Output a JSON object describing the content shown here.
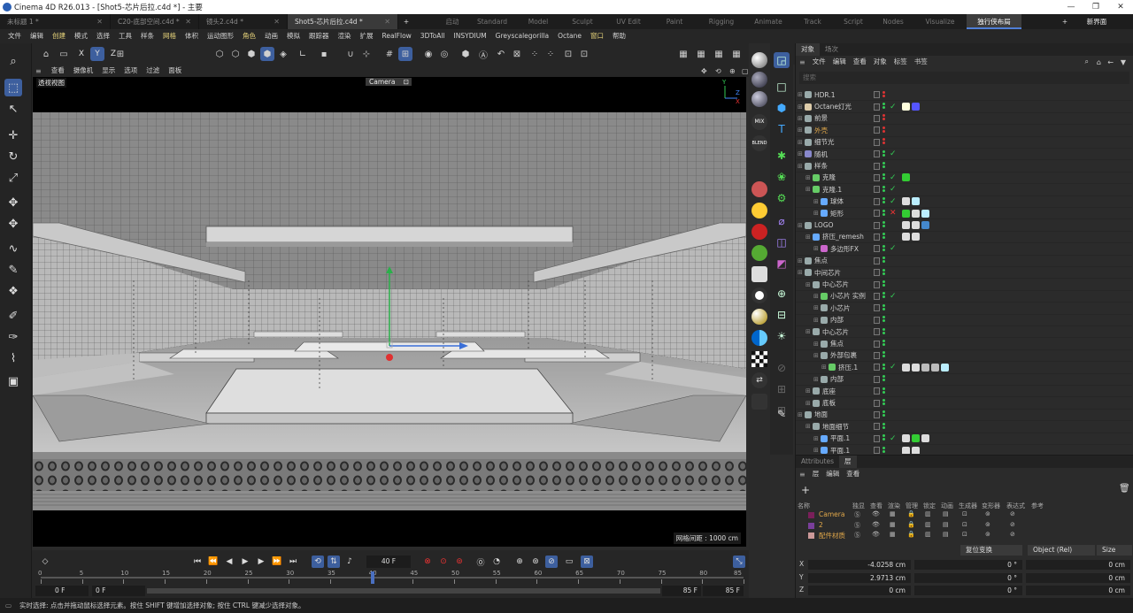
{
  "window": {
    "title": "Cinema 4D R26.013 - [Shot5-芯片后拉.c4d *] - 主要"
  },
  "file_tabs": [
    {
      "label": "未标题 1 *",
      "active": false
    },
    {
      "label": "C20-底部空间.c4d *",
      "active": false
    },
    {
      "label": "镜头2.c4d *",
      "active": false
    },
    {
      "label": "Shot5-芯片后拉.c4d *",
      "active": true
    }
  ],
  "new_tab": "+",
  "layouts": [
    "启动",
    "Standard",
    "Model",
    "Sculpt",
    "UV Edit",
    "Paint",
    "Rigging",
    "Animate",
    "Track",
    "Script",
    "Nodes",
    "Visualize",
    "独行侠布局"
  ],
  "layout_add": "+",
  "new_layout": "新界面",
  "menu": [
    "文件",
    "编辑",
    "创建",
    "模式",
    "选择",
    "工具",
    "样条",
    "网格",
    "体积",
    "运动图形",
    "角色",
    "动画",
    "模拟",
    "跟踪器",
    "渲染",
    "扩展",
    "RealFlow",
    "3DToAll",
    "INSYDIUM",
    "Greyscalegorilla",
    "Octane",
    "窗口",
    "帮助"
  ],
  "menu_highlight": [
    "创建",
    "网格",
    "角色",
    "窗口"
  ],
  "axis_toggles": [
    "X",
    "Y",
    "Z"
  ],
  "viewport": {
    "menu": [
      "查看",
      "摄像机",
      "显示",
      "选项",
      "过滤",
      "面板"
    ],
    "label": "透视视图",
    "camera": "Camera",
    "grid_spacing": "网格间距 : 1000 cm",
    "axis": {
      "y": "Y",
      "z": "Z",
      "x": "X"
    }
  },
  "object_manager": {
    "tabs": [
      "对象",
      "场次"
    ],
    "menu": [
      "文件",
      "编辑",
      "查看",
      "对象",
      "标签",
      "书签"
    ],
    "search_placeholder": "搜索",
    "rows": [
      {
        "name": "HDR.1",
        "indent": 0,
        "color": "#d0d0d0",
        "icon": "#9aa",
        "dots": [
          "#d33",
          "#d33"
        ],
        "check": "",
        "tags": []
      },
      {
        "name": "Octane灯光",
        "indent": 0,
        "color": "#d0d0d0",
        "icon": "#dca",
        "dots": [
          "#3c5",
          "#3c5"
        ],
        "check": "✓",
        "tags": [
          "#ffd",
          "#55f"
        ]
      },
      {
        "name": "前景",
        "indent": 0,
        "color": "#d0d0d0",
        "icon": "#9aa",
        "dots": [
          "#d33",
          "#d33"
        ],
        "check": "",
        "tags": []
      },
      {
        "name": "外壳",
        "indent": 0,
        "color": "#e2a84a",
        "icon": "#9aa",
        "dots": [
          "#d33",
          "#d33"
        ],
        "check": "",
        "tags": []
      },
      {
        "name": "细节光",
        "indent": 0,
        "color": "#d0d0d0",
        "icon": "#9aa",
        "dots": [
          "#d33",
          "#d33"
        ],
        "check": "",
        "tags": []
      },
      {
        "name": "随机",
        "indent": 0,
        "color": "#d0d0d0",
        "icon": "#88c",
        "dots": [
          "#3c5",
          "#3c5"
        ],
        "check": "✓",
        "tags": []
      },
      {
        "name": "样条",
        "indent": 0,
        "color": "#d0d0d0",
        "icon": "#9aa",
        "dots": [
          "#3c5",
          "#3c5"
        ],
        "check": "",
        "tags": []
      },
      {
        "name": "克隆",
        "indent": 1,
        "color": "#d0d0d0",
        "icon": "#6c6",
        "dots": [
          "#3c5",
          "#3c5"
        ],
        "check": "✓",
        "tags": [
          "#3c3"
        ]
      },
      {
        "name": "克隆.1",
        "indent": 1,
        "color": "#d0d0d0",
        "icon": "#6c6",
        "dots": [
          "#3c5",
          "#3c5"
        ],
        "check": "✓",
        "tags": []
      },
      {
        "name": "球体",
        "indent": 2,
        "color": "#d0d0d0",
        "icon": "#6af",
        "dots": [
          "#3c5",
          "#3c5"
        ],
        "check": "✓",
        "tags": [
          "#ddd",
          "#bef"
        ]
      },
      {
        "name": "矩形",
        "indent": 2,
        "color": "#d0d0d0",
        "icon": "#6af",
        "dots": [
          "#3c5",
          "#3c5"
        ],
        "check": "✕",
        "tags": [
          "#3c3",
          "#ddd",
          "#bef"
        ]
      },
      {
        "name": "LOGO",
        "indent": 0,
        "color": "#d0d0d0",
        "icon": "#9aa",
        "dots": [
          "#3c5",
          "#3c5"
        ],
        "check": "",
        "tags": [
          "#ddd",
          "#ddd",
          "#48c"
        ]
      },
      {
        "name": "挤压_remesh",
        "indent": 1,
        "color": "#d0d0d0",
        "icon": "#6af",
        "dots": [
          "#3c5",
          "#3c5"
        ],
        "check": "",
        "tags": [
          "#ddd",
          "#ddd"
        ]
      },
      {
        "name": "多边形FX",
        "indent": 2,
        "color": "#d0d0d0",
        "icon": "#c6c",
        "dots": [
          "#3c5",
          "#3c5"
        ],
        "check": "✓",
        "tags": []
      },
      {
        "name": "焦点",
        "indent": 0,
        "color": "#d0d0d0",
        "icon": "#9aa",
        "dots": [
          "#3c5",
          "#3c5"
        ],
        "check": "",
        "tags": []
      },
      {
        "name": "中间芯片",
        "indent": 0,
        "color": "#d0d0d0",
        "icon": "#9aa",
        "dots": [
          "#3c5",
          "#3c5"
        ],
        "check": "",
        "tags": []
      },
      {
        "name": "中心芯片",
        "indent": 1,
        "color": "#d0d0d0",
        "icon": "#9aa",
        "dots": [
          "#3c5",
          "#3c5"
        ],
        "check": "",
        "tags": []
      },
      {
        "name": "小芯片 实例",
        "indent": 2,
        "color": "#d0d0d0",
        "icon": "#6c6",
        "dots": [
          "#3c5",
          "#3c5"
        ],
        "check": "✓",
        "tags": []
      },
      {
        "name": "小芯片",
        "indent": 2,
        "color": "#d0d0d0",
        "icon": "#9aa",
        "dots": [
          "#3c5",
          "#3c5"
        ],
        "check": "",
        "tags": []
      },
      {
        "name": "内部",
        "indent": 2,
        "color": "#d0d0d0",
        "icon": "#9aa",
        "dots": [
          "#3c5",
          "#3c5"
        ],
        "check": "",
        "tags": []
      },
      {
        "name": "中心芯片",
        "indent": 1,
        "color": "#d0d0d0",
        "icon": "#9aa",
        "dots": [
          "#3c5",
          "#3c5"
        ],
        "check": "",
        "tags": []
      },
      {
        "name": "焦点",
        "indent": 2,
        "color": "#d0d0d0",
        "icon": "#9aa",
        "dots": [
          "#3c5",
          "#3c5"
        ],
        "check": "",
        "tags": []
      },
      {
        "name": "外部包裹",
        "indent": 2,
        "color": "#d0d0d0",
        "icon": "#9aa",
        "dots": [
          "#3c5",
          "#3c5"
        ],
        "check": "",
        "tags": []
      },
      {
        "name": "挤压.1",
        "indent": 3,
        "color": "#d0d0d0",
        "icon": "#6c6",
        "dots": [
          "#3c5",
          "#3c5"
        ],
        "check": "✓",
        "tags": [
          "#ddd",
          "#ddd",
          "#bbb",
          "#bbb",
          "#bef"
        ]
      },
      {
        "name": "内部",
        "indent": 2,
        "color": "#d0d0d0",
        "icon": "#9aa",
        "dots": [
          "#3c5",
          "#3c5"
        ],
        "check": "",
        "tags": []
      },
      {
        "name": "底座",
        "indent": 1,
        "color": "#d0d0d0",
        "icon": "#9aa",
        "dots": [
          "#3c5",
          "#3c5"
        ],
        "check": "",
        "tags": []
      },
      {
        "name": "底板",
        "indent": 1,
        "color": "#d0d0d0",
        "icon": "#9aa",
        "dots": [
          "#3c5",
          "#3c5"
        ],
        "check": "",
        "tags": []
      },
      {
        "name": "地面",
        "indent": 0,
        "color": "#d0d0d0",
        "icon": "#9aa",
        "dots": [
          "#3c5",
          "#3c5"
        ],
        "check": "",
        "tags": []
      },
      {
        "name": "地面细节",
        "indent": 1,
        "color": "#d0d0d0",
        "icon": "#9aa",
        "dots": [
          "#3c5",
          "#3c5"
        ],
        "check": "",
        "tags": []
      },
      {
        "name": "平面.1",
        "indent": 2,
        "color": "#d0d0d0",
        "icon": "#6af",
        "dots": [
          "#3c5",
          "#3c5"
        ],
        "check": "✓",
        "tags": [
          "#ddd",
          "#3c3",
          "#ddd"
        ]
      },
      {
        "name": "平面.1",
        "indent": 2,
        "color": "#d0d0d0",
        "icon": "#6af",
        "dots": [
          "#3c5",
          "#3c5"
        ],
        "check": "",
        "tags": [
          "#ddd",
          "#ddd"
        ]
      }
    ]
  },
  "attributes": {
    "tabs": [
      "Attributes",
      "层"
    ],
    "menu": [
      "层",
      "编辑",
      "查看"
    ],
    "add": "+",
    "headers": [
      "名称",
      "独显",
      "查看",
      "渲染",
      "管理",
      "锁定",
      "动画",
      "生成器",
      "变形器",
      "表达式",
      "参考"
    ],
    "layers": [
      {
        "name": "Camera",
        "color": "#e2a84a",
        "swatch": "#7a1f5a"
      },
      {
        "name": "2",
        "color": "#e2a84a",
        "swatch": "#7a3f9a"
      },
      {
        "name": "配件材质",
        "color": "#e2a84a",
        "swatch": "#c99"
      }
    ],
    "coord_buttons": [
      "复位变换",
      "Object (Rel)",
      "Size"
    ],
    "coords": [
      {
        "axis": "X",
        "pos": "-4.0258 cm",
        "rot": "0 °",
        "size": "0 cm"
      },
      {
        "axis": "Y",
        "pos": "2.9713 cm",
        "rot": "0 °",
        "size": "0 cm"
      },
      {
        "axis": "Z",
        "pos": "0 cm",
        "rot": "0 °",
        "size": "0 cm"
      }
    ]
  },
  "timeline": {
    "frame": "40 F",
    "ticks": [
      "0",
      "5",
      "10",
      "15",
      "20",
      "25",
      "30",
      "35",
      "40",
      "45",
      "50",
      "55",
      "60",
      "65",
      "70",
      "75",
      "80",
      "85"
    ],
    "start": "0 F",
    "start2": "0 F",
    "end": "85 F",
    "end2": "85 F",
    "playhead_fraction": 0.47
  },
  "status": "实时选择: 点击并拖动鼠标选择元素。按住 SHIFT 键增加选择对象; 按住 CTRL 键减少选择对象。"
}
